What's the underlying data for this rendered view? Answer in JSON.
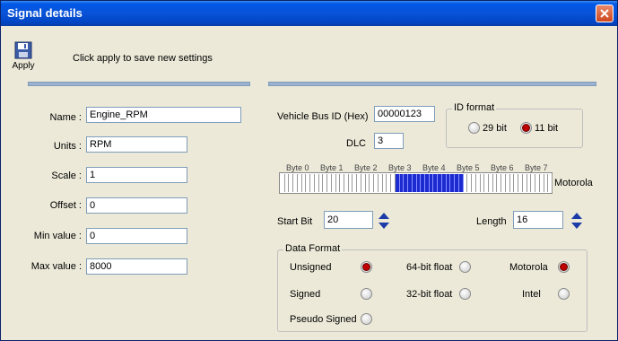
{
  "window": {
    "title": "Signal details"
  },
  "toolbar": {
    "apply_label": "Apply",
    "hint": "Click apply to save new settings"
  },
  "left": {
    "fields": [
      {
        "label": "Name :",
        "value": "Engine_RPM"
      },
      {
        "label": "Units :",
        "value": "RPM"
      },
      {
        "label": "Scale :",
        "value": "1"
      },
      {
        "label": "Offset :",
        "value": "0"
      },
      {
        "label": "Min value :",
        "value": "0"
      },
      {
        "label": "Max value :",
        "value": "8000"
      }
    ]
  },
  "right": {
    "bus_id_label": "Vehicle Bus ID (Hex)",
    "bus_id_value": "00000123",
    "dlc_label": "DLC",
    "dlc_value": "3",
    "id_format": {
      "legend": "ID format",
      "opt_29": "29 bit",
      "opt_11": "11 bit",
      "selected": "11 bit"
    },
    "byte_labels": [
      "Byte 0",
      "Byte 1",
      "Byte 2",
      "Byte 3",
      "Byte 4",
      "Byte 5",
      "Byte 6",
      "Byte 7"
    ],
    "bit_layout_label": "Motorola",
    "bits_selected_from": 20,
    "bits_selected_count": 16,
    "start_bit_label": "Start Bit",
    "start_bit_value": "20",
    "length_label": "Length",
    "length_value": "16",
    "data_format": {
      "legend": "Data Format",
      "unsigned": "Unsigned",
      "signed": "Signed",
      "pseudo_signed": "Pseudo Signed",
      "float64": "64-bit float",
      "float32": "32-bit float",
      "motorola": "Motorola",
      "intel": "Intel",
      "selected_type": "Unsigned",
      "selected_order": "Motorola"
    }
  },
  "colors": {
    "selected_bit": "#1c2bd0",
    "radio_on": "#c00000",
    "titlebar": "#0058e6"
  },
  "icons": {
    "apply": "floppy-disk-icon",
    "close": "close-icon",
    "spin": "up-down-arrows-icon"
  }
}
